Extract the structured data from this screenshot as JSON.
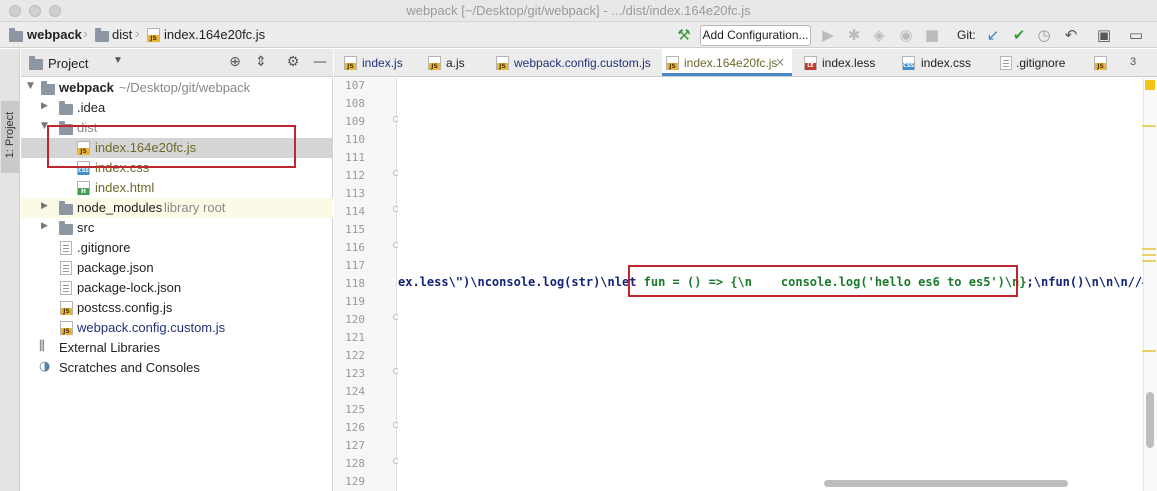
{
  "window": {
    "title": "webpack [~/Desktop/git/webpack] - .../dist/index.164e20fc.js"
  },
  "breadcrumb": {
    "project": "webpack",
    "folder": "dist",
    "file": "index.164e20fc.js"
  },
  "toolbar": {
    "run_config_label": "Add Configuration...",
    "git_label": "Git:",
    "icons": [
      "hammer-icon",
      "run-icon",
      "debug-icon",
      "coverage-icon",
      "profile-icon",
      "stop-icon",
      "git-update-icon",
      "git-commit-icon",
      "history-icon",
      "revert-icon",
      "project-structure-icon",
      "terminal-icon"
    ]
  },
  "stripe": {
    "tab_label": "1: Project"
  },
  "project_panel": {
    "title": "Project",
    "root_name": "webpack",
    "root_path": "~/Desktop/git/webpack",
    "items": [
      {
        "name": ".idea",
        "type": "folder"
      },
      {
        "name": "dist",
        "type": "folder"
      },
      {
        "name": "index.164e20fc.js",
        "type": "js"
      },
      {
        "name": "index.css",
        "type": "css"
      },
      {
        "name": "index.html",
        "type": "html"
      },
      {
        "name": "node_modules",
        "type": "folder",
        "note": "library root"
      },
      {
        "name": "src",
        "type": "folder"
      },
      {
        "name": ".gitignore",
        "type": "file"
      },
      {
        "name": "package.json",
        "type": "file"
      },
      {
        "name": "package-lock.json",
        "type": "file"
      },
      {
        "name": "postcss.config.js",
        "type": "js"
      },
      {
        "name": "webpack.config.custom.js",
        "type": "js"
      }
    ],
    "external_libraries": "External Libraries",
    "scratches": "Scratches and Consoles"
  },
  "tabs": [
    {
      "label": "index.js",
      "type": "js",
      "active": false
    },
    {
      "label": "a.js",
      "type": "js",
      "active": false
    },
    {
      "label": "webpack.config.custom.js",
      "type": "js",
      "active": false
    },
    {
      "label": "index.164e20fc.js",
      "type": "js",
      "active": true
    },
    {
      "label": "index.less",
      "type": "less",
      "active": false
    },
    {
      "label": "index.css",
      "type": "css",
      "active": false
    },
    {
      "label": ".gitignore",
      "type": "file",
      "active": false
    }
  ],
  "tabs_overflow": "3",
  "editor": {
    "line_numbers": [
      "107",
      "108",
      "109",
      "110",
      "111",
      "112",
      "113",
      "114",
      "115",
      "116",
      "117",
      "118",
      "119",
      "120",
      "121",
      "122",
      "123",
      "124",
      "125",
      "126",
      "127",
      "128",
      "129"
    ],
    "code_line_118": {
      "plain_part": "ex.less\\\")\\nconsole.log(str)\\nlet ",
      "highlighted_part": "fun = () => {\\n    console.log('hello es6 to es5')\\n}",
      "tail_part": ";\\nfun()\\n\\n\\n//# sourc"
    }
  },
  "colors": {
    "accent": "#4a86c8",
    "highlight_box": "#c0262d",
    "code_string": "#1b7a2c",
    "code_plain": "#13237a"
  }
}
